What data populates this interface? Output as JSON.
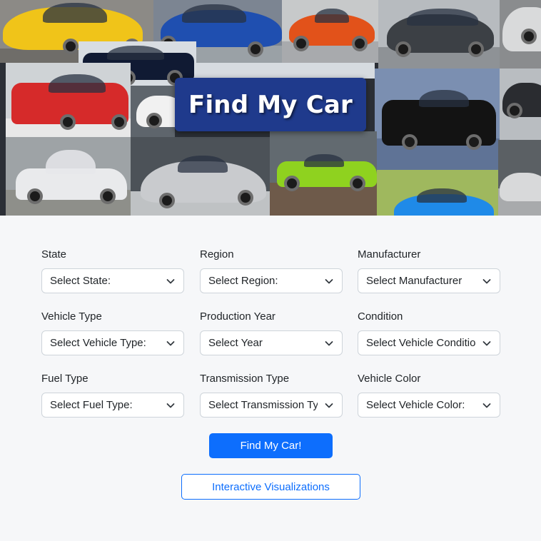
{
  "hero": {
    "title": "Find My Car"
  },
  "form": {
    "rows": [
      [
        {
          "label": "State",
          "value": "Select State:"
        },
        {
          "label": "Region",
          "value": "Select Region:"
        },
        {
          "label": "Manufacturer",
          "value": "Select Manufacturer"
        }
      ],
      [
        {
          "label": "Vehicle Type",
          "value": "Select Vehicle Type:"
        },
        {
          "label": "Production Year",
          "value": "Select Year"
        },
        {
          "label": "Condition",
          "value": "Select Vehicle Condition"
        }
      ],
      [
        {
          "label": "Fuel Type",
          "value": "Select Fuel Type:"
        },
        {
          "label": "Transmission Type",
          "value": "Select Transmission Type"
        },
        {
          "label": "Vehicle Color",
          "value": "Select Vehicle Color:"
        }
      ]
    ]
  },
  "actions": {
    "find_label": "Find My Car!",
    "viz_label": "Interactive Visualizations"
  },
  "colors": {
    "primary": "#0d6efd",
    "banner": "#1f3a8c",
    "page_bg": "#f6f7f9"
  }
}
